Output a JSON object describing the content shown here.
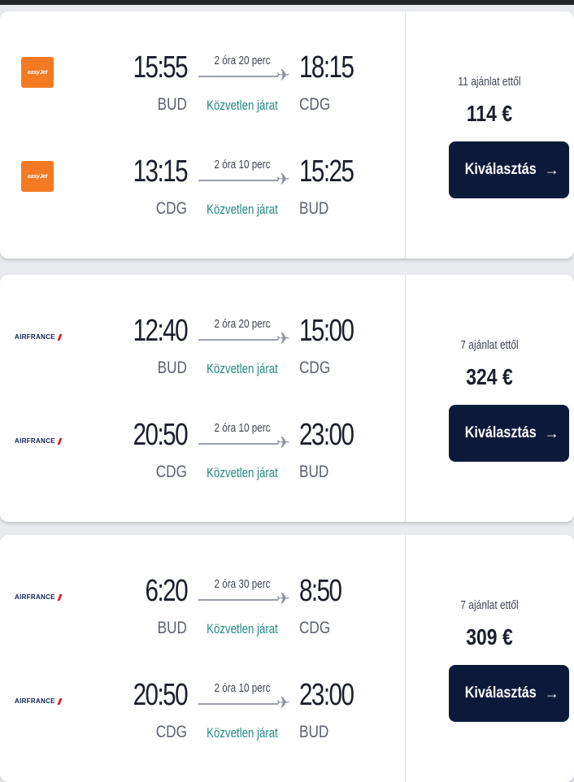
{
  "results": [
    {
      "legs": [
        {
          "airline": "easyJet",
          "logo": "easyjet-logo",
          "dep_time": "15:55",
          "dep_code": "BUD",
          "duration": "2 óra 20 perc",
          "direct": "Közvetlen járat",
          "arr_time": "18:15",
          "arr_code": "CDG"
        },
        {
          "airline": "easyJet",
          "logo": "easyjet-logo",
          "dep_time": "13:15",
          "dep_code": "CDG",
          "duration": "2 óra 10 perc",
          "direct": "Közvetlen járat",
          "arr_time": "15:25",
          "arr_code": "BUD"
        }
      ],
      "offers": "11 ajánlat ettől",
      "price": "114 €",
      "button": "Kiválasztás",
      "button_icon": "arrow-right-icon"
    },
    {
      "legs": [
        {
          "airline": "AIRFRANCE",
          "logo": "airfrance-logo",
          "dep_time": "12:40",
          "dep_code": "BUD",
          "duration": "2 óra 20 perc",
          "direct": "Közvetlen járat",
          "arr_time": "15:00",
          "arr_code": "CDG"
        },
        {
          "airline": "AIRFRANCE",
          "logo": "airfrance-logo",
          "dep_time": "20:50",
          "dep_code": "CDG",
          "duration": "2 óra 10 perc",
          "direct": "Közvetlen járat",
          "arr_time": "23:00",
          "arr_code": "BUD"
        }
      ],
      "offers": "7 ajánlat ettől",
      "price": "324 €",
      "button": "Kiválasztás",
      "button_icon": "arrow-right-icon"
    },
    {
      "legs": [
        {
          "airline": "AIRFRANCE",
          "logo": "airfrance-logo",
          "dep_time": "6:20",
          "dep_code": "BUD",
          "duration": "2 óra 30 perc",
          "direct": "Közvetlen járat",
          "arr_time": "8:50",
          "arr_code": "CDG"
        },
        {
          "airline": "AIRFRANCE",
          "logo": "airfrance-logo",
          "dep_time": "20:50",
          "dep_code": "CDG",
          "duration": "2 óra 10 perc",
          "direct": "Közvetlen járat",
          "arr_time": "23:00",
          "arr_code": "BUD"
        }
      ],
      "offers": "7 ajánlat ettől",
      "price": "309 €",
      "button": "Kiválasztás",
      "button_icon": "arrow-right-icon"
    }
  ],
  "colors": {
    "accent": "#0c1a3a",
    "direct": "#1f8a80",
    "easyjet": "#f37a22",
    "airfrance_red": "#d9252b",
    "airfrance_blue": "#0b1f52"
  }
}
